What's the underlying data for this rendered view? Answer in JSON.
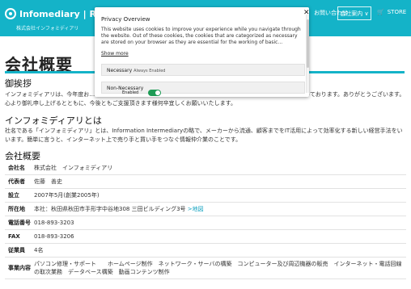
{
  "header": {
    "logo_text": "Infomediary | Re:DA",
    "logo_sub": "株式会社インフォミディアリ",
    "nav_contact": "お問い合わせ",
    "nav_company": "会社案内 ∨",
    "nav_store": "STORE",
    "bg_color": "#14b3c8"
  },
  "page": {
    "title": "会社概要"
  },
  "greeting": {
    "heading": "御挨拶",
    "text": "インフォミディアリは、今年度お…………………………………………………………………………………………………思っております。ありがとうございます。心より御礼申し上げるとともに、今後ともご支援頂きます様何卒宜しくお願いいたします。"
  },
  "about": {
    "heading": "インフォミディアリとは",
    "text": "社名である「インフォミディアリ」とは、Information Intermediaryの略で、メーカーから流通、顧客までをIT活用によって効率化する新しい経営手法をいいます。簡単に言うと、インターネット上で売り手と買い手をつなぐ情報仲介業のことです。"
  },
  "overview": {
    "heading": "会社概要",
    "rows": [
      {
        "key": "会社名",
        "value": "株式会社　インフォミディアリ"
      },
      {
        "key": "代表者",
        "value": "佐藤　善史"
      },
      {
        "key": "設立",
        "value": "2007年5月(創業2005年)"
      },
      {
        "key": "所在地",
        "value": "本社：秋田県秋田市手形字中谷地308 三田ビルディング3号",
        "link": ">地図"
      },
      {
        "key": "電話番号",
        "value": "018-893-3203"
      },
      {
        "key": "FAX",
        "value": "018-893-3206"
      },
      {
        "key": "従業員",
        "value": "4名"
      },
      {
        "key": "事業内容",
        "value": "パソコン修理・サポート　　ホームページ制作　ネットワーク・サーバの構築　コンピューター及び周辺機器の販売　インターネット・電話回線の取次業務　データベース構築　動画コンテンツ制作"
      }
    ]
  },
  "privacy": {
    "title": "Privacy Overview",
    "body": "This website uses cookies to improve your experience while you navigate through the website. Out of these cookies, the cookies that are categorized as necessary are stored on your browser as they are essential for the working of basic...",
    "show_more": "Show more",
    "necessary_label": "Necessary",
    "necessary_note": "Always Enabled",
    "non_necessary_label": "Non-Necessary",
    "enabled_label": "Enabled",
    "close_icon": "✕",
    "toggle_color": "#1d9b55"
  }
}
